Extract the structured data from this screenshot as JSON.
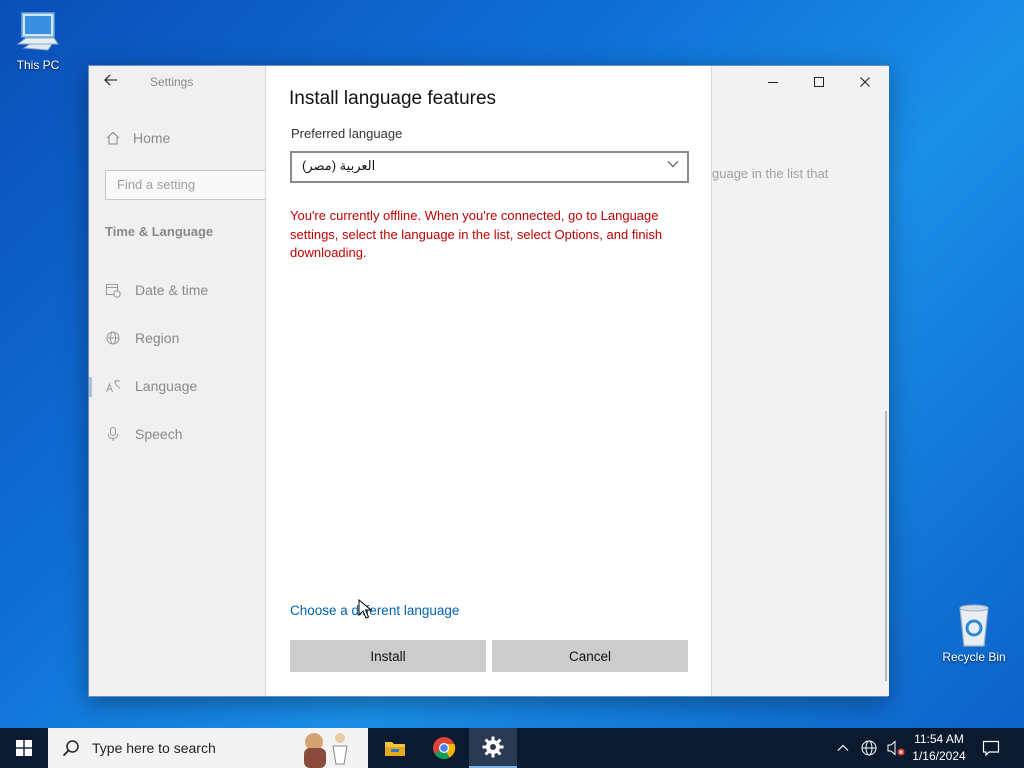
{
  "desktop": {
    "this_pc_label": "This PC",
    "recycle_bin_label": "Recycle Bin"
  },
  "settings": {
    "app_title": "Settings",
    "nav_home": "Home",
    "search_placeholder": "Find a setting",
    "section_title": "Time & Language",
    "nav_items": [
      {
        "label": "Date & time",
        "icon": "calendar-clock-icon"
      },
      {
        "label": "Region",
        "icon": "globe-icon"
      },
      {
        "label": "Language",
        "icon": "language-icon"
      },
      {
        "label": "Speech",
        "icon": "microphone-icon"
      }
    ],
    "active_item": "Language",
    "right_pane_text": "guage in the list that"
  },
  "dialog": {
    "title": "Install language features",
    "preferred_label": "Preferred language",
    "selected_language": "العربية (مصر)",
    "offline_message": "You're currently offline. When you're connected, go to Language settings, select the language in the list, select Options, and finish downloading.",
    "choose_link": "Choose a different language",
    "install_button": "Install",
    "cancel_button": "Cancel"
  },
  "taskbar": {
    "search_placeholder": "Type here to search",
    "time": "11:54 AM",
    "date": "1/16/2024",
    "apps": [
      "file-explorer-icon",
      "chrome-icon",
      "settings-gear-icon"
    ],
    "active_app": "settings-gear-icon"
  },
  "colors": {
    "accent": "#0063b1",
    "error": "#c00000",
    "taskbar": "#0b1a2e"
  }
}
